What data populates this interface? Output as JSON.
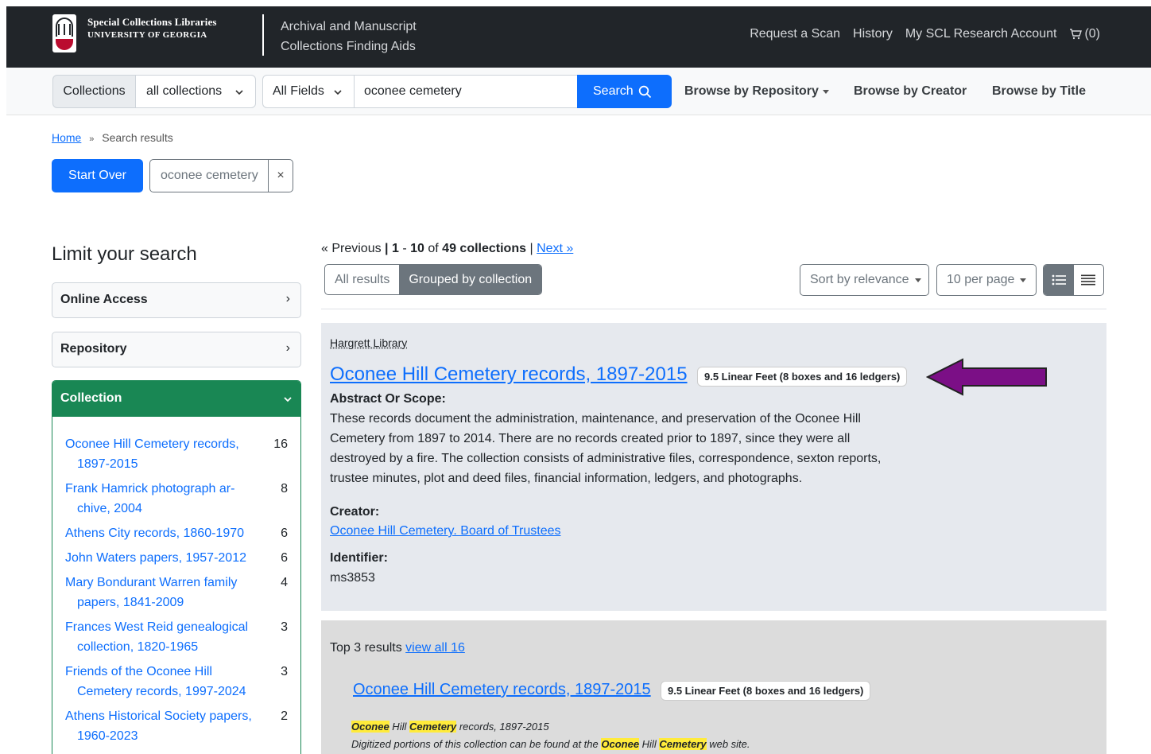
{
  "header": {
    "brand_line1": "Special Collections Libraries",
    "brand_line2": "UNIVERSITY OF GEORGIA",
    "app_title_line1": "Archival and Manuscript",
    "app_title_line2": "Collections Finding Aids",
    "links": [
      "Request a Scan",
      "History",
      "My SCL Research Account"
    ],
    "cart_count": "(0)"
  },
  "search": {
    "scope_label": "Collections",
    "scope_value": "all collections",
    "field_value": "All Fields",
    "query": "oconee cemetery",
    "button_label": "Search"
  },
  "nav": {
    "browse_repository": "Browse by Repository",
    "browse_creator": "Browse by Creator",
    "browse_title": "Browse by Title"
  },
  "breadcrumb": {
    "home": "Home",
    "sep": "»",
    "current": "Search results"
  },
  "constraints": {
    "start_over": "Start Over",
    "query_chip": "oconee cemetery",
    "remove": "×"
  },
  "sidebar": {
    "title": "Limit your search",
    "facets": [
      {
        "label": "Online Access",
        "arrow": "›"
      },
      {
        "label": "Repository",
        "arrow": "›"
      }
    ],
    "open_facet": {
      "label": "Collection",
      "items": [
        {
          "name": "Oconee Hill Cemetery records, 1897-2015",
          "count": "16"
        },
        {
          "name": "Frank Hamrick photograph ar­chive, 2004",
          "count": "8"
        },
        {
          "name": "Athens City records, 1860-1970",
          "count": "6"
        },
        {
          "name": "John Waters papers, 1957-2012",
          "count": "6"
        },
        {
          "name": "Mary Bondurant Warren family pa­pers, 1841-2009",
          "count": "4"
        },
        {
          "name": "Frances West Reid genealogical collection, 1820-1965",
          "count": "3"
        },
        {
          "name": "Friends of the Oconee Hill Cemetery records, 1997-2024",
          "count": "3"
        },
        {
          "name": "Athens Historical Society papers, 1960-2023",
          "count": "2"
        }
      ]
    }
  },
  "results": {
    "pager": {
      "previous": "« Previous",
      "sep": "|",
      "start": "1",
      "dash": "-",
      "end": "10",
      "of": "of",
      "total": "49 collections",
      "next": "Next »"
    },
    "view_toggle": [
      "All results",
      "Grouped by collection"
    ],
    "sort_label": "Sort by relevance",
    "per_page_label": "10 per page",
    "first": {
      "repository": "Hargrett Library",
      "title": "Oconee Hill Cemetery records, 1897-2015",
      "extent": "9.5 Linear Feet (8 boxes and 16 ledgers)",
      "abstract_label": "Abstract Or Scope:",
      "abstract_lines": [
        "These records document the administration, maintenance, and preservation of the Oconee Hill",
        "Cemetery from 1897 to 2014. There are no records created prior to 1897, since they were all",
        "destroyed by a fire. The collection consists of administrative files, correspondence, sexton reports,",
        "trustee minutes, plot and deed files, financial information, ledgers, and photographs."
      ],
      "creator_label": "Creator:",
      "creator": "Oconee Hill Cemetery. Board of Trustees",
      "identifier_label": "Identifier:",
      "identifier": "ms3853"
    },
    "group": {
      "top_label": "Top 3 results",
      "view_all": "view all 16",
      "title": "Oconee Hill Cemetery records, 1897-2015",
      "extent": "9.5 Linear Feet (8 boxes and 16 ledgers)",
      "snippet1": {
        "h1": "Oconee",
        "t1": " Hill ",
        "h2": "Cemetery",
        "t2": " records, 1897-2015"
      },
      "snippet2": {
        "t1": "Digitized portions of this collection can be found at the ",
        "h1": "Oconee",
        "t2": " Hill ",
        "h2": "Cemetery",
        "t3": " web site."
      }
    }
  },
  "colors": {
    "header_bg": "#212529",
    "primary": "#0d6efd",
    "facet_green": "#198754",
    "annotation_arrow": "#7b0f86"
  }
}
